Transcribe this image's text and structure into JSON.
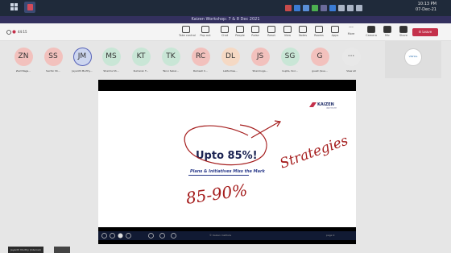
{
  "window": {
    "title": "Kaizen Workshop: 7 & 8 Dec 2021"
  },
  "clock": {
    "time": "10:13 PM",
    "date": "07-Dec-21"
  },
  "meeting": {
    "elapsed": "44:15"
  },
  "toolbar": {
    "items": [
      "Take control",
      "Pop out",
      "Chat",
      "People",
      "Raise",
      "React",
      "View",
      "Notes",
      "Rooms",
      "Apps",
      "More",
      "Camera",
      "Mic",
      "Share"
    ],
    "leave_label": "Leave"
  },
  "participants": [
    {
      "initials": "ZN",
      "name": "Zaid Naga...",
      "color": "#f2c1bd"
    },
    {
      "initials": "SS",
      "name": "Sachin Sh...",
      "color": "#f2c1bd"
    },
    {
      "initials": "JM",
      "name": "Jayanth Murthy...",
      "color": "#cdd6ef"
    },
    {
      "initials": "MS",
      "name": "Sharma Sh...",
      "color": "#c9e6d6"
    },
    {
      "initials": "KT",
      "name": "Kumaran T...",
      "color": "#c9e6d6"
    },
    {
      "initials": "TK",
      "name": "Tanvi Sekar...",
      "color": "#c9e6d6"
    },
    {
      "initials": "RC",
      "name": "Ramesh C...",
      "color": "#f2c1bd"
    },
    {
      "initials": "DL",
      "name": "Lalita Dee...",
      "color": "#f5d9c4"
    },
    {
      "initials": "JS",
      "name": "Shanmuga...",
      "color": "#f2c1bd"
    },
    {
      "initials": "SG",
      "name": "Gupta, Sivr...",
      "color": "#c9e6d6"
    },
    {
      "initials": "G",
      "name": "guest (Gue...",
      "color": "#f2c1bd"
    },
    {
      "initials": "···",
      "name": "View all",
      "color": "#e8e8e8"
    }
  ],
  "self_tile_label": "VISHAL",
  "slide": {
    "brand": "KAIZEN",
    "brand_sub": "INSTITUTE",
    "headline": "Upto 85%!",
    "subline": "Plans & Initiatives Miss the Mark",
    "footer_center": "© Kaizen Institute",
    "footer_right": "page 9",
    "annotation_word": "Strategies",
    "annotation_number": "85-90%"
  },
  "presenter_name": "Jayanth Murthy (Internal)"
}
